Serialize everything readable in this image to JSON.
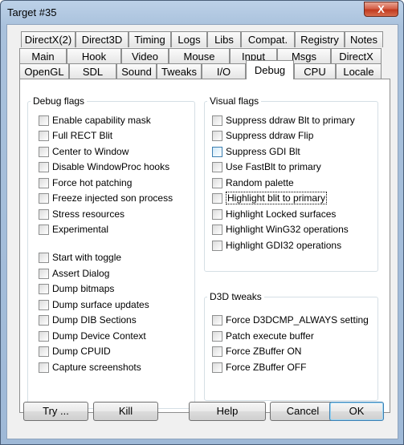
{
  "window": {
    "title": "Target #35",
    "close_symbol": "X"
  },
  "tabs": {
    "row1": [
      "DirectX(2)",
      "Direct3D",
      "Timing",
      "Logs",
      "Libs",
      "Compat.",
      "Registry",
      "Notes"
    ],
    "row2": [
      "Main",
      "Hook",
      "Video",
      "Mouse",
      "Input",
      "Msgs",
      "DirectX"
    ],
    "row3": [
      "OpenGL",
      "SDL",
      "Sound",
      "Tweaks",
      "I/O",
      "Debug",
      "CPU",
      "Locale"
    ],
    "active": "Debug"
  },
  "debug_flags": {
    "title": "Debug flags",
    "items": [
      "Enable capability mask",
      "Full RECT Blit",
      "Center to Window",
      "Disable WindowProc hooks",
      "Force hot patching",
      "Freeze injected son process",
      "Stress resources",
      "Experimental",
      "Start with toggle",
      "Assert Dialog",
      "Dump bitmaps",
      "Dump surface updates",
      "Dump DIB Sections",
      "Dump Device Context",
      "Dump CPUID",
      "Capture screenshots"
    ]
  },
  "visual_flags": {
    "title": "Visual flags",
    "items": [
      "Suppress ddraw Blt to primary",
      "Suppress ddraw Flip",
      "Suppress GDI Blt",
      "Use FastBlt to primary",
      "Random palette",
      "Highlight blit to primary",
      "Highlight Locked surfaces",
      "Highlight WinG32 operations",
      "Highlight GDI32 operations"
    ]
  },
  "d3d_tweaks": {
    "title": "D3D tweaks",
    "items": [
      "Force D3DCMP_ALWAYS setting",
      "Patch execute buffer",
      "Force ZBuffer ON",
      "Force ZBuffer OFF"
    ]
  },
  "buttons": {
    "try": "Try ...",
    "kill": "Kill",
    "help": "Help",
    "cancel": "Cancel",
    "ok": "OK"
  }
}
